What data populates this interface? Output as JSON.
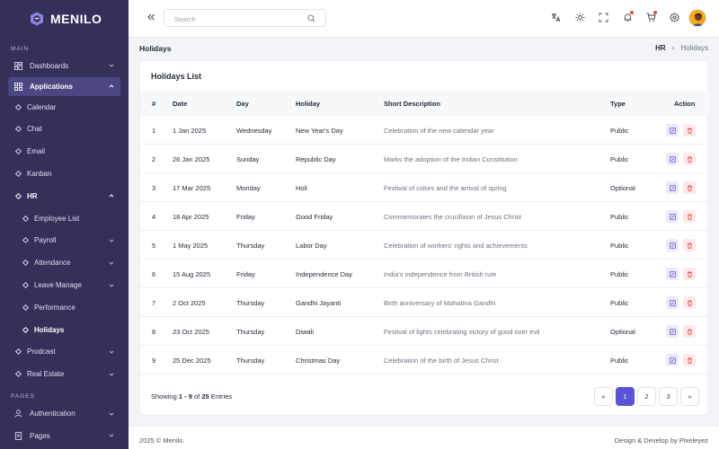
{
  "brand": {
    "name": "MENILO"
  },
  "sidebar": {
    "main_label": "MAIN",
    "pages_label": "PAGES",
    "items": {
      "dashboards": "Dashboards",
      "applications": "Applications",
      "calendar": "Calendar",
      "chat": "Chat",
      "email": "Email",
      "kanban": "Kanban",
      "hr": "HR",
      "employee_list": "Employee List",
      "payroll": "Payroll",
      "attendance": "Attendance",
      "leave_manage": "Leave Manage",
      "performance": "Performance",
      "holidays": "Holidays",
      "prodcast": "Prodcast",
      "real_estate": "Real Estate",
      "authentication": "Authentication",
      "pages": "Pages"
    }
  },
  "header": {
    "search_placeholder": "Search"
  },
  "page": {
    "title": "Holidays",
    "breadcrumb": [
      "HR",
      "›",
      "Holidays"
    ]
  },
  "card": {
    "title": "Holidays List",
    "columns": [
      "#",
      "Date",
      "Day",
      "Holiday",
      "Short Description",
      "Type",
      "Action"
    ],
    "rows": [
      [
        "1",
        "1 Jan 2025",
        "Wednesday",
        "New Year's Day",
        "Celebration of the new calendar year",
        "Public"
      ],
      [
        "2",
        "26 Jan 2025",
        "Sunday",
        "Republic Day",
        "Marks the adoption of the Indian Constitution",
        "Public"
      ],
      [
        "3",
        "17 Mar 2025",
        "Monday",
        "Holi",
        "Festival of colors and the arrival of spring",
        "Optional"
      ],
      [
        "4",
        "18 Apr 2025",
        "Friday",
        "Good Friday",
        "Commemorates the crucifixion of Jesus Christ",
        "Public"
      ],
      [
        "5",
        "1 May 2025",
        "Thursday",
        "Labor Day",
        "Celebration of workers' rights and achievements",
        "Public"
      ],
      [
        "6",
        "15 Aug 2025",
        "Friday",
        "Independence Day",
        "India's independence from British rule",
        "Public"
      ],
      [
        "7",
        "2 Oct 2025",
        "Thursday",
        "Gandhi Jayanti",
        "Birth anniversary of Mahatma Gandhi",
        "Public"
      ],
      [
        "8",
        "23 Oct 2025",
        "Thursday",
        "Diwali",
        "Festival of lights celebrating victory of good over evil",
        "Optional"
      ],
      [
        "9",
        "25 Dec 2025",
        "Thursday",
        "Christmas Day",
        "Celebration of the birth of Jesus Christ",
        "Public"
      ]
    ],
    "showing": {
      "prefix": "Showing",
      "range": "1 - 9",
      "of": "of",
      "total": "25",
      "suffix": "Entries"
    },
    "pagination": {
      "prev": "«",
      "pages": [
        "1",
        "2",
        "3"
      ],
      "next": "»",
      "current": "1"
    }
  },
  "footer": {
    "copyright": "2025 © Menilo.",
    "credit": "Design & Develop by Pixeleyez"
  },
  "colors": {
    "sidebar_bg": "#34305a",
    "accent": "#5b54d6",
    "notification": "#ef4444"
  },
  "icons": [
    "dashboard-icon",
    "applications-icon",
    "menu-collapse-icon",
    "search-icon",
    "translate-icon",
    "theme-sun-icon",
    "fullscreen-icon",
    "bell-icon",
    "cart-icon",
    "settings-icon",
    "user-icon",
    "pages-icon",
    "edit-icon",
    "trash-icon"
  ]
}
